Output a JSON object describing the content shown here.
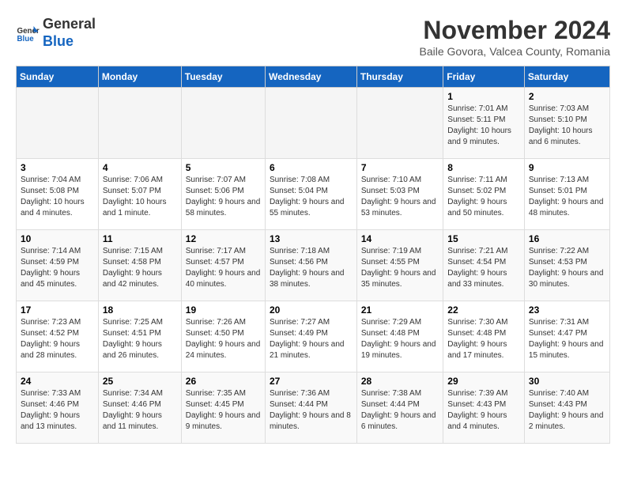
{
  "logo": {
    "general": "General",
    "blue": "Blue"
  },
  "header": {
    "month_year": "November 2024",
    "location": "Baile Govora, Valcea County, Romania"
  },
  "weekdays": [
    "Sunday",
    "Monday",
    "Tuesday",
    "Wednesday",
    "Thursday",
    "Friday",
    "Saturday"
  ],
  "weeks": [
    [
      {
        "day": "",
        "info": ""
      },
      {
        "day": "",
        "info": ""
      },
      {
        "day": "",
        "info": ""
      },
      {
        "day": "",
        "info": ""
      },
      {
        "day": "",
        "info": ""
      },
      {
        "day": "1",
        "info": "Sunrise: 7:01 AM\nSunset: 5:11 PM\nDaylight: 10 hours and 9 minutes."
      },
      {
        "day": "2",
        "info": "Sunrise: 7:03 AM\nSunset: 5:10 PM\nDaylight: 10 hours and 6 minutes."
      }
    ],
    [
      {
        "day": "3",
        "info": "Sunrise: 7:04 AM\nSunset: 5:08 PM\nDaylight: 10 hours and 4 minutes."
      },
      {
        "day": "4",
        "info": "Sunrise: 7:06 AM\nSunset: 5:07 PM\nDaylight: 10 hours and 1 minute."
      },
      {
        "day": "5",
        "info": "Sunrise: 7:07 AM\nSunset: 5:06 PM\nDaylight: 9 hours and 58 minutes."
      },
      {
        "day": "6",
        "info": "Sunrise: 7:08 AM\nSunset: 5:04 PM\nDaylight: 9 hours and 55 minutes."
      },
      {
        "day": "7",
        "info": "Sunrise: 7:10 AM\nSunset: 5:03 PM\nDaylight: 9 hours and 53 minutes."
      },
      {
        "day": "8",
        "info": "Sunrise: 7:11 AM\nSunset: 5:02 PM\nDaylight: 9 hours and 50 minutes."
      },
      {
        "day": "9",
        "info": "Sunrise: 7:13 AM\nSunset: 5:01 PM\nDaylight: 9 hours and 48 minutes."
      }
    ],
    [
      {
        "day": "10",
        "info": "Sunrise: 7:14 AM\nSunset: 4:59 PM\nDaylight: 9 hours and 45 minutes."
      },
      {
        "day": "11",
        "info": "Sunrise: 7:15 AM\nSunset: 4:58 PM\nDaylight: 9 hours and 42 minutes."
      },
      {
        "day": "12",
        "info": "Sunrise: 7:17 AM\nSunset: 4:57 PM\nDaylight: 9 hours and 40 minutes."
      },
      {
        "day": "13",
        "info": "Sunrise: 7:18 AM\nSunset: 4:56 PM\nDaylight: 9 hours and 38 minutes."
      },
      {
        "day": "14",
        "info": "Sunrise: 7:19 AM\nSunset: 4:55 PM\nDaylight: 9 hours and 35 minutes."
      },
      {
        "day": "15",
        "info": "Sunrise: 7:21 AM\nSunset: 4:54 PM\nDaylight: 9 hours and 33 minutes."
      },
      {
        "day": "16",
        "info": "Sunrise: 7:22 AM\nSunset: 4:53 PM\nDaylight: 9 hours and 30 minutes."
      }
    ],
    [
      {
        "day": "17",
        "info": "Sunrise: 7:23 AM\nSunset: 4:52 PM\nDaylight: 9 hours and 28 minutes."
      },
      {
        "day": "18",
        "info": "Sunrise: 7:25 AM\nSunset: 4:51 PM\nDaylight: 9 hours and 26 minutes."
      },
      {
        "day": "19",
        "info": "Sunrise: 7:26 AM\nSunset: 4:50 PM\nDaylight: 9 hours and 24 minutes."
      },
      {
        "day": "20",
        "info": "Sunrise: 7:27 AM\nSunset: 4:49 PM\nDaylight: 9 hours and 21 minutes."
      },
      {
        "day": "21",
        "info": "Sunrise: 7:29 AM\nSunset: 4:48 PM\nDaylight: 9 hours and 19 minutes."
      },
      {
        "day": "22",
        "info": "Sunrise: 7:30 AM\nSunset: 4:48 PM\nDaylight: 9 hours and 17 minutes."
      },
      {
        "day": "23",
        "info": "Sunrise: 7:31 AM\nSunset: 4:47 PM\nDaylight: 9 hours and 15 minutes."
      }
    ],
    [
      {
        "day": "24",
        "info": "Sunrise: 7:33 AM\nSunset: 4:46 PM\nDaylight: 9 hours and 13 minutes."
      },
      {
        "day": "25",
        "info": "Sunrise: 7:34 AM\nSunset: 4:46 PM\nDaylight: 9 hours and 11 minutes."
      },
      {
        "day": "26",
        "info": "Sunrise: 7:35 AM\nSunset: 4:45 PM\nDaylight: 9 hours and 9 minutes."
      },
      {
        "day": "27",
        "info": "Sunrise: 7:36 AM\nSunset: 4:44 PM\nDaylight: 9 hours and 8 minutes."
      },
      {
        "day": "28",
        "info": "Sunrise: 7:38 AM\nSunset: 4:44 PM\nDaylight: 9 hours and 6 minutes."
      },
      {
        "day": "29",
        "info": "Sunrise: 7:39 AM\nSunset: 4:43 PM\nDaylight: 9 hours and 4 minutes."
      },
      {
        "day": "30",
        "info": "Sunrise: 7:40 AM\nSunset: 4:43 PM\nDaylight: 9 hours and 2 minutes."
      }
    ]
  ]
}
